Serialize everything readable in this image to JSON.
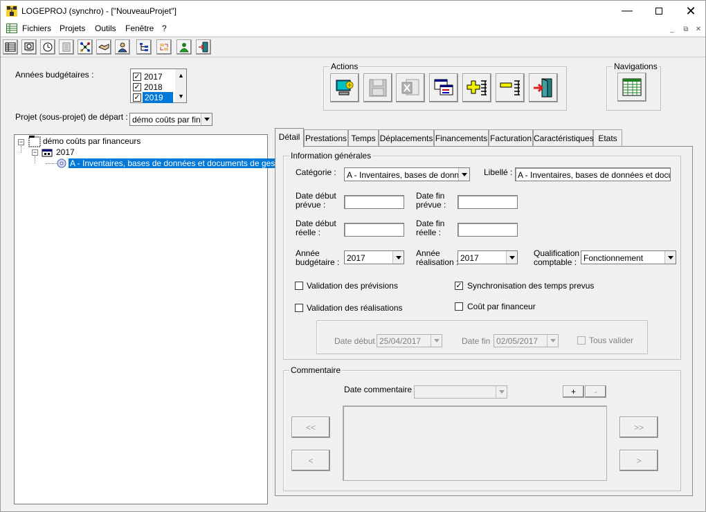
{
  "window": {
    "title": "LOGEPROJ (synchro) - [\"NouveauProjet\"]",
    "controls": [
      "minimize-icon",
      "maximize-icon",
      "close-icon"
    ]
  },
  "menu": {
    "items": [
      "Fichiers",
      "Projets",
      "Outils",
      "Fenêtre",
      "?"
    ]
  },
  "toolbar": {
    "icons": [
      "table-icon",
      "budget-icon",
      "clock-icon",
      "document-icon",
      "network-icon",
      "handshake-icon",
      "user-icon",
      "tree-chart-icon",
      "transfer-icon",
      "people-icon",
      "exit-door-icon"
    ]
  },
  "filters": {
    "years_label": "Années budgétaires :",
    "years": [
      {
        "label": "2017",
        "checked": true,
        "selected": false
      },
      {
        "label": "2018",
        "checked": true,
        "selected": false
      },
      {
        "label": "2019",
        "checked": true,
        "selected": true
      }
    ],
    "project_label": "Projet (sous-projet) de départ :",
    "project_value": "démo coûts par finan"
  },
  "actions": {
    "title": "Actions",
    "buttons": [
      "computer-wizard-icon",
      "save-disk-icon",
      "excel-export-icon",
      "window-list-icon",
      "add-row-icon",
      "remove-row-icon",
      "exit-door-icon"
    ]
  },
  "navigations": {
    "title": "Navigations",
    "button_icon": "spreadsheet-icon"
  },
  "tree": {
    "root": "démo coûts par financeurs",
    "year": "2017",
    "item": "A - Inventaires, bases de données et documents de gestion"
  },
  "tabs": [
    "Détail",
    "Prestations",
    "Temps",
    "Déplacements",
    "Financements",
    "Facturation",
    "Caractéristiques",
    "Etats"
  ],
  "detail": {
    "info_title": "Information générales",
    "categorie_label": "Catégorie  :",
    "categorie_value": "A - Inventaires, bases de données",
    "libelle_label": "Libellé  :",
    "libelle_value": "A - Inventaires, bases de données et documen",
    "date_debut_prevue_label": [
      "Date début",
      "prévue :"
    ],
    "date_fin_prevue_label": [
      "Date fin",
      "prévue :"
    ],
    "date_debut_reelle_label": [
      "Date début",
      "réelle :"
    ],
    "date_fin_reelle_label": [
      "Date fin",
      "réelle :"
    ],
    "annee_budgetaire_label": [
      "Année",
      "budgétaire :"
    ],
    "annee_budgetaire_value": "2017",
    "annee_realisation_label": [
      "Année",
      "réalisation :"
    ],
    "annee_realisation_value": "2017",
    "qualification_label": [
      "Qualification",
      "comptable :"
    ],
    "qualification_value": "Fonctionnement",
    "validation_previsions": {
      "label": "Validation des prévisions",
      "checked": false
    },
    "synchronisation": {
      "label": "Synchronisation des temps prevus",
      "checked": true
    },
    "validation_realisations": {
      "label": "Validation des réalisations",
      "checked": false
    },
    "cout_financeur": {
      "label": "Coût par financeur",
      "checked": false
    },
    "sub_date_debut_label": "Date début :",
    "sub_date_debut_value": "25/04/2017",
    "sub_date_fin_label": "Date fin :",
    "sub_date_fin_value": "02/05/2017",
    "tous_valider": {
      "label": "Tous valider",
      "checked": false
    }
  },
  "commentaire": {
    "title": "Commentaire",
    "date_label": "Date commentaire :",
    "plus": "+",
    "minus": "-",
    "first": "<<",
    "prev": "<",
    "next": ">>",
    "last": ">"
  }
}
